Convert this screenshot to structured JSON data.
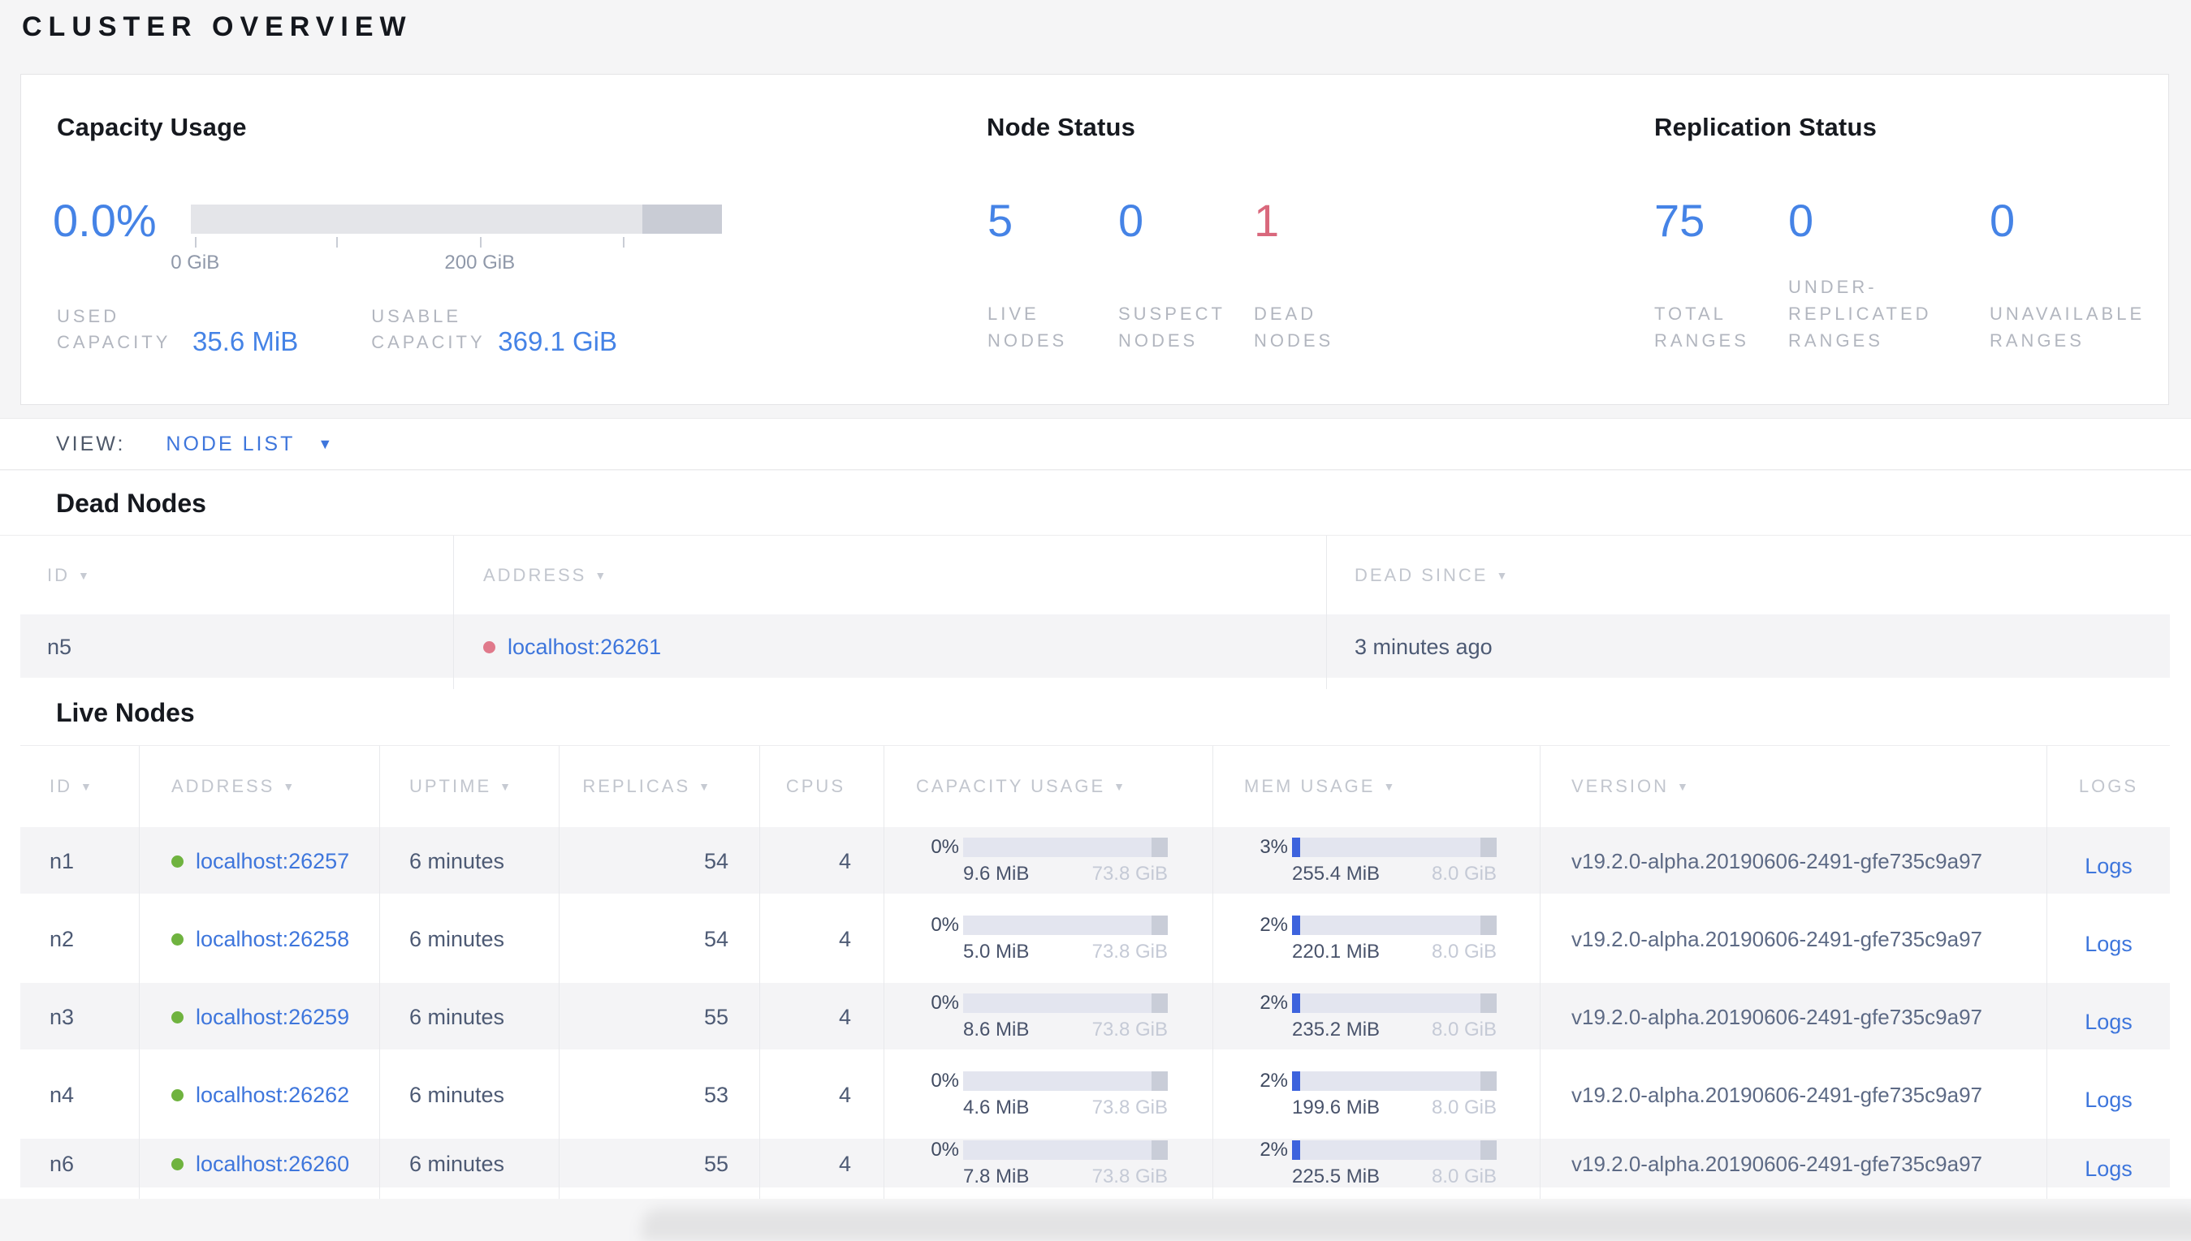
{
  "page_title": "CLUSTER OVERVIEW",
  "summary": {
    "capacity": {
      "title": "Capacity Usage",
      "percent": "0.0%",
      "axis_ticks": [
        {
          "label": "0 GiB"
        },
        {
          "label": ""
        },
        {
          "label": "200 GiB"
        },
        {
          "label": ""
        }
      ],
      "stats": [
        {
          "label_lines": [
            "USED",
            "CAPACITY"
          ],
          "value": "35.6 MiB"
        },
        {
          "label_lines": [
            "USABLE",
            "CAPACITY"
          ],
          "value": "369.1 GiB"
        }
      ]
    },
    "node_status": {
      "title": "Node Status",
      "cells": [
        {
          "value": "5",
          "label_lines": [
            "LIVE",
            "NODES"
          ],
          "tone": "blue"
        },
        {
          "value": "0",
          "label_lines": [
            "SUSPECT",
            "NODES"
          ],
          "tone": "blue"
        },
        {
          "value": "1",
          "label_lines": [
            "DEAD",
            "NODES"
          ],
          "tone": "red"
        }
      ]
    },
    "replication_status": {
      "title": "Replication Status",
      "cells": [
        {
          "value": "75",
          "label_lines": [
            "TOTAL",
            "RANGES"
          ],
          "tone": "blue"
        },
        {
          "value": "0",
          "label_lines": [
            "UNDER-",
            "REPLICATED",
            "RANGES"
          ],
          "tone": "blue"
        },
        {
          "value": "0",
          "label_lines": [
            "UNAVAILABLE",
            "RANGES"
          ],
          "tone": "blue"
        }
      ]
    }
  },
  "view_bar": {
    "label": "VIEW:",
    "selected": "NODE LIST"
  },
  "dead_nodes": {
    "title": "Dead Nodes",
    "columns": [
      {
        "label": "ID",
        "sortable": true
      },
      {
        "label": "ADDRESS",
        "sortable": true
      },
      {
        "label": "DEAD SINCE",
        "sortable": true
      }
    ],
    "rows": [
      {
        "id": "n5",
        "address": "localhost:26261",
        "status": "dead",
        "dead_since": "3 minutes ago"
      }
    ]
  },
  "live_nodes": {
    "title": "Live Nodes",
    "columns": [
      {
        "label": "ID",
        "sortable": true
      },
      {
        "label": "ADDRESS",
        "sortable": true
      },
      {
        "label": "UPTIME",
        "sortable": true
      },
      {
        "label": "REPLICAS",
        "sortable": true
      },
      {
        "label": "CPUS",
        "sortable": false
      },
      {
        "label": "CAPACITY USAGE",
        "sortable": true
      },
      {
        "label": "MEM USAGE",
        "sortable": true
      },
      {
        "label": "VERSION",
        "sortable": true
      },
      {
        "label": "LOGS",
        "sortable": false
      }
    ],
    "rows": [
      {
        "id": "n1",
        "address": "localhost:26257",
        "status": "live",
        "uptime": "6 minutes",
        "replicas": "54",
        "cpus": "4",
        "capacity": {
          "percent": "0%",
          "percent_value": 0,
          "used": "9.6 MiB",
          "total": "73.8 GiB"
        },
        "memory": {
          "percent": "3%",
          "percent_value": 3,
          "used": "255.4 MiB",
          "total": "8.0 GiB"
        },
        "version": "v19.2.0-alpha.20190606-2491-gfe735c9a97",
        "logs_label": "Logs"
      },
      {
        "id": "n2",
        "address": "localhost:26258",
        "status": "live",
        "uptime": "6 minutes",
        "replicas": "54",
        "cpus": "4",
        "capacity": {
          "percent": "0%",
          "percent_value": 0,
          "used": "5.0 MiB",
          "total": "73.8 GiB"
        },
        "memory": {
          "percent": "2%",
          "percent_value": 2,
          "used": "220.1 MiB",
          "total": "8.0 GiB"
        },
        "version": "v19.2.0-alpha.20190606-2491-gfe735c9a97",
        "logs_label": "Logs"
      },
      {
        "id": "n3",
        "address": "localhost:26259",
        "status": "live",
        "uptime": "6 minutes",
        "replicas": "55",
        "cpus": "4",
        "capacity": {
          "percent": "0%",
          "percent_value": 0,
          "used": "8.6 MiB",
          "total": "73.8 GiB"
        },
        "memory": {
          "percent": "2%",
          "percent_value": 2,
          "used": "235.2 MiB",
          "total": "8.0 GiB"
        },
        "version": "v19.2.0-alpha.20190606-2491-gfe735c9a97",
        "logs_label": "Logs"
      },
      {
        "id": "n4",
        "address": "localhost:26262",
        "status": "live",
        "uptime": "6 minutes",
        "replicas": "53",
        "cpus": "4",
        "capacity": {
          "percent": "0%",
          "percent_value": 0,
          "used": "4.6 MiB",
          "total": "73.8 GiB"
        },
        "memory": {
          "percent": "2%",
          "percent_value": 2,
          "used": "199.6 MiB",
          "total": "8.0 GiB"
        },
        "version": "v19.2.0-alpha.20190606-2491-gfe735c9a97",
        "logs_label": "Logs"
      },
      {
        "id": "n6",
        "address": "localhost:26260",
        "status": "live",
        "uptime": "6 minutes",
        "replicas": "55",
        "cpus": "4",
        "capacity": {
          "percent": "0%",
          "percent_value": 0,
          "used": "7.8 MiB",
          "total": "73.8 GiB"
        },
        "memory": {
          "percent": "2%",
          "percent_value": 2,
          "used": "225.5 MiB",
          "total": "8.0 GiB"
        },
        "version": "v19.2.0-alpha.20190606-2491-gfe735c9a97",
        "logs_label": "Logs"
      }
    ]
  },
  "colors": {
    "accent_blue": "#4583e6",
    "link_blue": "#3e76dc",
    "danger_red": "#d9687c",
    "live_green": "#6fb33f",
    "dead_red": "#e0798b",
    "bar_track": "#e3e5ef",
    "bar_reserved": "#c9cdd8",
    "bar_fill": "#3d63dd"
  }
}
